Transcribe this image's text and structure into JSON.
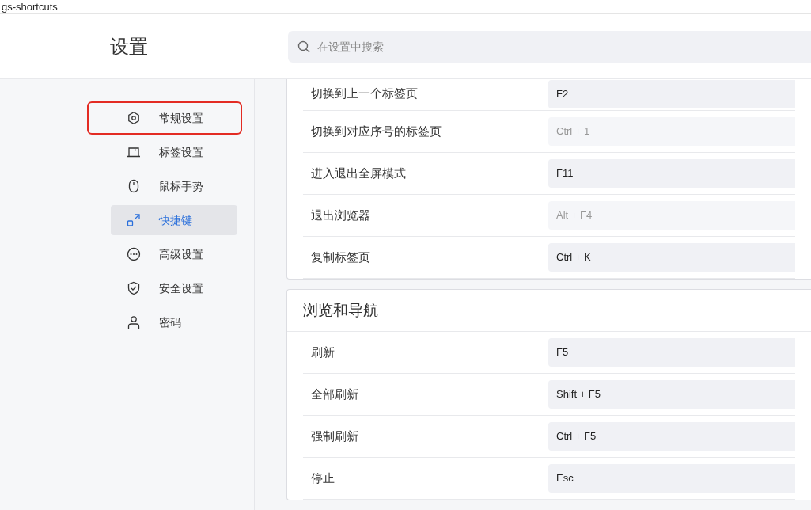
{
  "window": {
    "title": "gs-shortcuts"
  },
  "header": {
    "title": "设置",
    "search": {
      "placeholder": "在设置中搜索"
    }
  },
  "sidebar": {
    "items": [
      {
        "label": "常规设置",
        "kind": "hexagon",
        "selected": false,
        "highlighted": true
      },
      {
        "label": "标签设置",
        "kind": "tab",
        "selected": false,
        "highlighted": false
      },
      {
        "label": "鼠标手势",
        "kind": "mouse",
        "selected": false,
        "highlighted": false
      },
      {
        "label": "快捷键",
        "kind": "shortcut",
        "selected": true,
        "highlighted": false
      },
      {
        "label": "高级设置",
        "kind": "more",
        "selected": false,
        "highlighted": false
      },
      {
        "label": "安全设置",
        "kind": "shield",
        "selected": false,
        "highlighted": false
      },
      {
        "label": "密码",
        "kind": "user",
        "selected": false,
        "highlighted": false
      }
    ]
  },
  "sections": [
    {
      "rows": [
        {
          "label": "切换到上一个标签页",
          "key": "F2",
          "disabled": false
        },
        {
          "label": "切换到对应序号的标签页",
          "key": "Ctrl + 1",
          "disabled": true
        },
        {
          "label": "进入退出全屏模式",
          "key": "F11",
          "disabled": false
        },
        {
          "label": "退出浏览器",
          "key": "Alt + F4",
          "disabled": true
        },
        {
          "label": "复制标签页",
          "key": "Ctrl + K",
          "disabled": false
        }
      ]
    },
    {
      "title": "浏览和导航",
      "rows": [
        {
          "label": "刷新",
          "key": "F5",
          "disabled": false
        },
        {
          "label": "全部刷新",
          "key": "Shift + F5",
          "disabled": false
        },
        {
          "label": "强制刷新",
          "key": "Ctrl + F5",
          "disabled": false
        },
        {
          "label": "停止",
          "key": "Esc",
          "disabled": false
        }
      ]
    }
  ]
}
